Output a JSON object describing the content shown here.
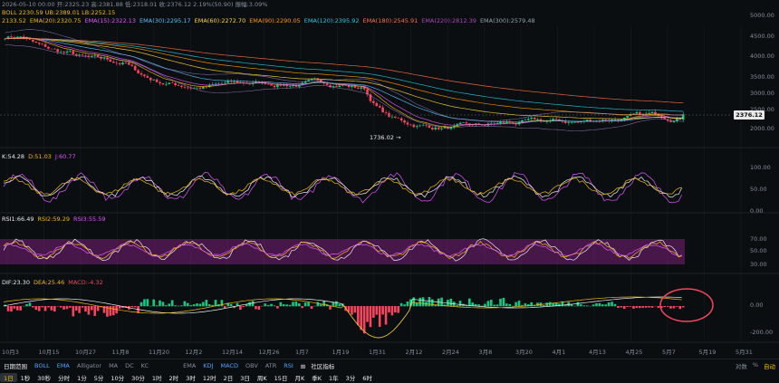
{
  "header": {
    "ohlc": "2026-05-10 00:00 开:2325.23 高:2381.88 低:2318.01 收:2376.12 2.19%(50.90) 振幅:3.09%",
    "boll": "BOLL 2230.59 UB:2389.01 LB:2252.15",
    "ema": [
      {
        "text": "2133.52",
        "color": "#f0b90b"
      },
      {
        "text": "EMA(20):2320.75",
        "color": "#f0b90b"
      },
      {
        "text": "EMA(15):2322.13",
        "color": "#e056fd"
      },
      {
        "text": "EMA(30):2295.17",
        "color": "#4fc3f7"
      },
      {
        "text": "EMA(60):2272.70",
        "color": "#fdd835"
      },
      {
        "text": "EMA(90):2290.05",
        "color": "#ff9800"
      },
      {
        "text": "EMA(120):2395.92",
        "color": "#26c6da"
      },
      {
        "text": "EMA(180):2545.91",
        "color": "#ff7043"
      },
      {
        "text": "EMA(220):2812.39",
        "color": "#ab47bc"
      },
      {
        "text": "EMA(300):2579.48",
        "color": "#90a4ae"
      }
    ]
  },
  "price_axis": [
    "5000.00",
    "4500.00",
    "4000.00",
    "3500.00",
    "3000.00",
    "2500.00",
    "2000.00"
  ],
  "last_price": "2376.12",
  "low_label": "1736.02",
  "kdj": {
    "legend": [
      {
        "text": "K:54.28",
        "color": "#eaecef"
      },
      {
        "text": "D:51.03",
        "color": "#f0b90b"
      },
      {
        "text": "J:60.77",
        "color": "#e056fd"
      }
    ],
    "axis": [
      "100.00",
      "50.00",
      "0.00"
    ]
  },
  "rsi": {
    "legend": [
      {
        "text": "RSI1:66.49",
        "color": "#eaecef"
      },
      {
        "text": "RSI2:59.29",
        "color": "#f0b90b"
      },
      {
        "text": "RSI3:55.59",
        "color": "#e056fd"
      }
    ],
    "axis": [
      "70.00",
      "50.00",
      "30.00"
    ]
  },
  "macd": {
    "legend": [
      {
        "text": "DIF:23.30",
        "color": "#eaecef"
      },
      {
        "text": "DEA:25.46",
        "color": "#f0b90b"
      },
      {
        "text": "MACD:-4.32",
        "color": "#f6465d"
      }
    ],
    "axis": [
      "0.00",
      "-200.00"
    ]
  },
  "x_labels": [
    "10月3",
    "10月15",
    "10月27",
    "11月8",
    "11月20",
    "12月2",
    "12月14",
    "12月26",
    "1月7",
    "1月19",
    "1月31",
    "2月12",
    "2月24",
    "3月8",
    "3月20",
    "4月1",
    "4月13",
    "4月25",
    "5月7",
    "5月19",
    "5月31"
  ],
  "toolbar1": {
    "date_range": "日期范围",
    "indicators": [
      "BOLL",
      "EMA",
      "Alligator",
      "MA",
      "DC",
      "KC",
      "EMA",
      "KDJ",
      "MACD",
      "OBV",
      "ATR",
      "RSI"
    ],
    "community": "社区指标",
    "right": [
      "对数",
      "%",
      "自动"
    ]
  },
  "toolbar2": {
    "timeframes": [
      "1日",
      "1秒",
      "30秒",
      "分时",
      "1分",
      "5分",
      "10分",
      "30分",
      "1时",
      "2时",
      "3时",
      "12时",
      "2日",
      "3日",
      "周K",
      "15日",
      "月K",
      "季K",
      "1年",
      "3分",
      "6时"
    ],
    "selected": "1日"
  },
  "colors": {
    "up": "#0ecb81",
    "down": "#f6465d",
    "bg": "#0b0e11",
    "grid": "#1a1e24",
    "annotation": "#f6465d"
  },
  "chart_data": {
    "type": "candlestick",
    "ylim": [
      1600,
      5200
    ],
    "start": 4450,
    "low": 1736.02,
    "last": 2376.12
  }
}
